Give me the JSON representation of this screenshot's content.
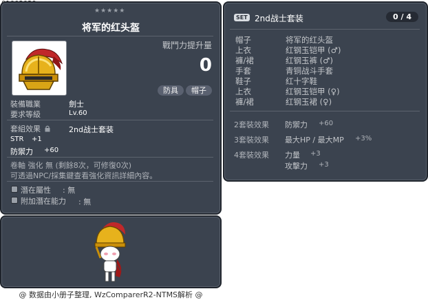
{
  "item_id": "01002029",
  "tooltip": {
    "stars": "★★★★★",
    "item_name": "将军的红头盔",
    "attack_increase_label": "戰鬥力提升量",
    "attack_increase_value": "0",
    "tags": [
      "防具",
      "帽子"
    ],
    "job_label": "裝備職業",
    "job_value": "劍士",
    "req_level_label": "要求等級",
    "req_level_value": "Lv.60",
    "set_effect_label": "套組效果",
    "set_effect_value": "2nd战士套装",
    "stats": [
      {
        "name": "STR",
        "value": "+1"
      },
      {
        "name": "防禦力",
        "value": "+60"
      }
    ],
    "scroll_line": "卷軸 強化 無 (剩餘8次，可修復0次)",
    "npc_line": "可透過NPC/採集鍵查看強化資訊詳細內容。",
    "potential_label": "潛在屬性",
    "potential_value": ": 無",
    "additional_potential_label": "附加潛在能力",
    "additional_potential_value": ": 無"
  },
  "set_panel": {
    "badge": "SET",
    "set_name": "2nd战士套装",
    "count": "0 / 4",
    "pieces": [
      {
        "slot": "帽子",
        "name": "将军的红头盔"
      },
      {
        "slot": "上衣",
        "name": "红钢玉铠甲 (♂)"
      },
      {
        "slot": "褲/裙",
        "name": "红钢玉裤 (♂)"
      },
      {
        "slot": "手套",
        "name": "青铜战斗手套"
      },
      {
        "slot": "鞋子",
        "name": "红十字鞋"
      },
      {
        "slot": "上衣",
        "name": "红钢玉铠甲 (♀)"
      },
      {
        "slot": "褲/裙",
        "name": "红钢玉裙 (♀)"
      }
    ],
    "bonuses": [
      {
        "label": "2套裝效果",
        "stats": [
          {
            "name": "防禦力",
            "value": "+60"
          }
        ]
      },
      {
        "label": "3套裝效果",
        "stats": [
          {
            "name": "最大HP / 最大MP",
            "value": "+3%"
          }
        ]
      },
      {
        "label": "4套裝效果",
        "stats": [
          {
            "name": "力量",
            "value": "+3"
          },
          {
            "name": "攻擊力",
            "value": "+3"
          }
        ]
      }
    ]
  },
  "footer": "@ 数据由小册子整理, WzComparerR2-NTMS解析 @",
  "colors": {
    "panel_bg": "#3b434f",
    "panel_border": "#1f242c",
    "tag_bg": "#5a6170",
    "text_light": "#c3c6ca"
  }
}
